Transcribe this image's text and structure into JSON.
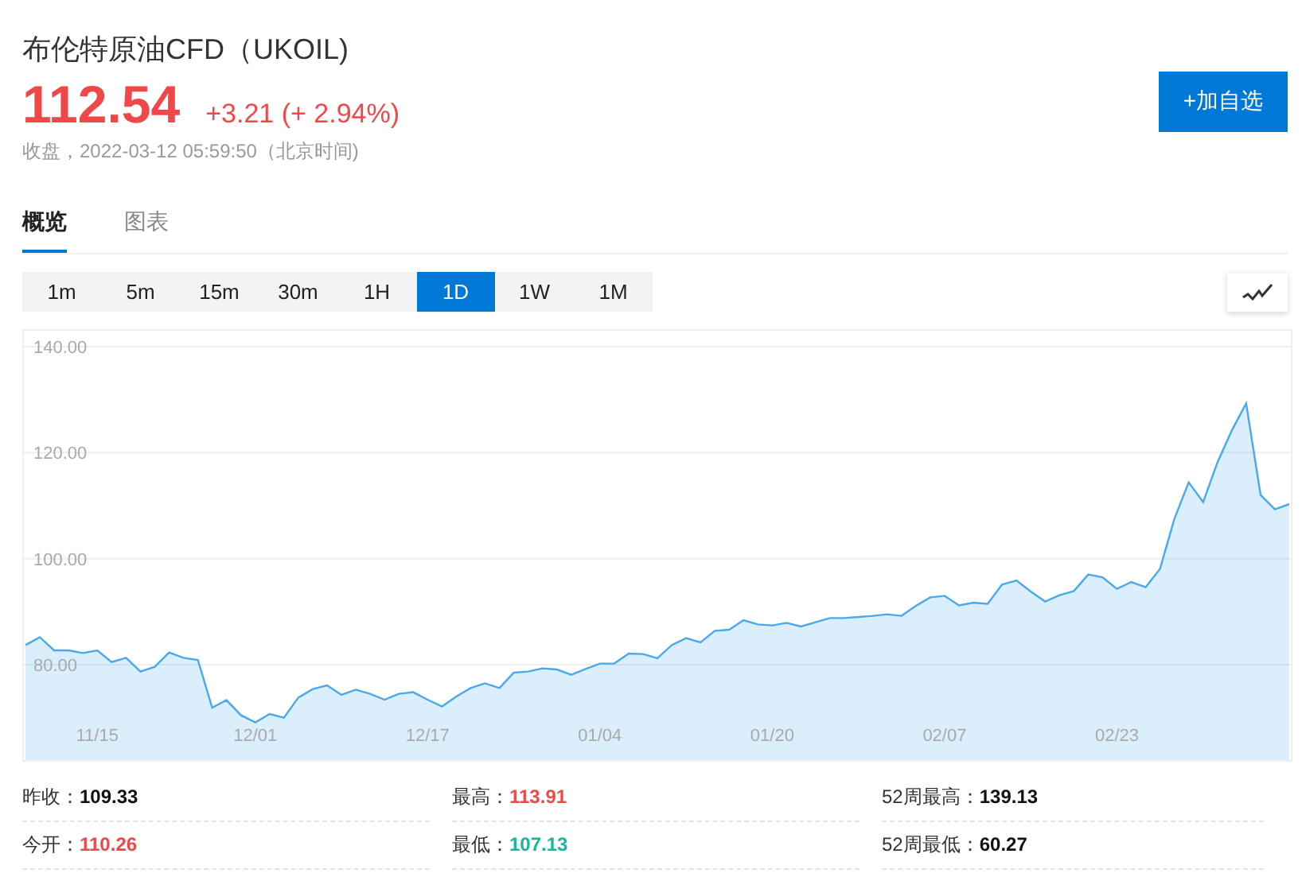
{
  "header": {
    "title": "布伦特原油CFD（UKOIL)",
    "price": "112.54",
    "change": "+3.21 (+ 2.94%)",
    "status": "收盘，2022-03-12 05:59:50（北京时间)",
    "add_button": "+加自选"
  },
  "tabs": [
    {
      "label": "概览",
      "selected": true
    },
    {
      "label": "图表",
      "selected": false
    }
  ],
  "periods": [
    {
      "label": "1m",
      "selected": false
    },
    {
      "label": "5m",
      "selected": false
    },
    {
      "label": "15m",
      "selected": false
    },
    {
      "label": "30m",
      "selected": false
    },
    {
      "label": "1H",
      "selected": false
    },
    {
      "label": "1D",
      "selected": true
    },
    {
      "label": "1W",
      "selected": false
    },
    {
      "label": "1M",
      "selected": false
    }
  ],
  "chart": {
    "chart_data": {
      "type": "area",
      "categories": [
        null,
        null,
        null,
        null,
        null,
        "11/15",
        null,
        null,
        null,
        null,
        null,
        null,
        null,
        null,
        null,
        null,
        "12/01",
        null,
        null,
        null,
        null,
        null,
        null,
        null,
        null,
        null,
        null,
        null,
        "12/17",
        null,
        null,
        null,
        null,
        null,
        null,
        null,
        null,
        null,
        null,
        null,
        "01/04",
        null,
        null,
        null,
        null,
        null,
        null,
        null,
        null,
        null,
        null,
        null,
        "01/20",
        null,
        null,
        null,
        null,
        null,
        null,
        null,
        null,
        null,
        null,
        null,
        "02/07",
        null,
        null,
        null,
        null,
        null,
        null,
        null,
        null,
        null,
        null,
        null,
        "02/23",
        null,
        null,
        null,
        null,
        null,
        null,
        null,
        null,
        null,
        null,
        null,
        null
      ],
      "series": [
        {
          "color": "#4aa8ee",
          "values": [
            83.7,
            85.2,
            82.7,
            82.7,
            82.2,
            82.7,
            80.5,
            81.3,
            78.7,
            79.6,
            82.3,
            81.3,
            80.9,
            71.9,
            73.3,
            70.5,
            69.1,
            70.7,
            70,
            73.8,
            75.4,
            76.1,
            74.3,
            75.3,
            74.5,
            73.4,
            74.5,
            74.8,
            73.4,
            72.1,
            74,
            75.6,
            76.5,
            75.6,
            78.5,
            78.7,
            79.3,
            79.1,
            78.1,
            79.2,
            80.2,
            80.2,
            82.1,
            82,
            81.2,
            83.7,
            85,
            84.2,
            86.4,
            86.6,
            88.4,
            87.6,
            87.4,
            87.9,
            87.2,
            88,
            88.8,
            88.8,
            89,
            89.2,
            89.5,
            89.2,
            91.1,
            92.7,
            93,
            91.2,
            91.7,
            91.5,
            95.1,
            95.9,
            93.8,
            91.9,
            93.1,
            93.9,
            97,
            96.5,
            94.3,
            95.6,
            94.6,
            98.1,
            107.5,
            114.4,
            110.7,
            118.2,
            124.2,
            129.3,
            112,
            109.3,
            110.3
          ]
        }
      ],
      "ylim": [
        62,
        143
      ],
      "grid": true,
      "yticks": [
        {
          "value": 80,
          "label": "80.00"
        },
        {
          "value": 100,
          "label": "100.00"
        },
        {
          "value": 120,
          "label": "120.00"
        },
        {
          "value": 140,
          "label": "140.00"
        }
      ]
    }
  },
  "stats": [
    {
      "label": "昨收：",
      "value": "109.33",
      "color": "#111111"
    },
    {
      "label": "最高：",
      "value": "113.91",
      "color": "#f04848"
    },
    {
      "label": "52周最高：",
      "value": "139.13",
      "color": "#111111"
    },
    {
      "label": "今开：",
      "value": "110.26",
      "color": "#f04848"
    },
    {
      "label": "最低：",
      "value": "107.13",
      "color": "#13b99a"
    },
    {
      "label": "52周最低：",
      "value": "60.27",
      "color": "#111111"
    }
  ]
}
